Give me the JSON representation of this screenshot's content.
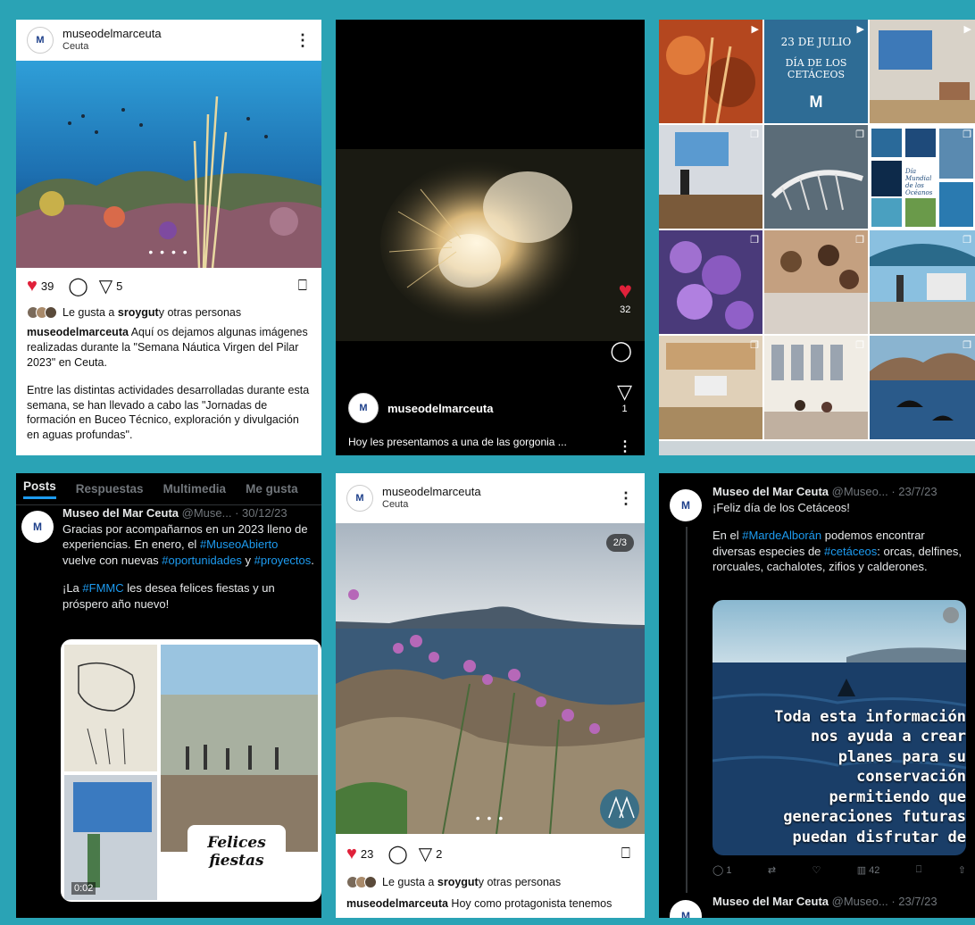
{
  "panel1": {
    "username": "museodelmarceuta",
    "location": "Ceuta",
    "logo_letter": "M",
    "likes_count": "39",
    "shares_count": "5",
    "liked_by_prefix": "Le gusta a ",
    "liked_by_user": "sroygut",
    "liked_by_suffix": " y otras personas",
    "caption_user": "museodelmarceuta",
    "caption_p1": " Aquí os dejamos algunas imágenes realizadas durante la \"Semana Náutica Virgen del Pilar 2023\" en Ceuta.",
    "caption_p2": "Entre las distintas actividades desarrolladas durante esta semana, se han llevado a cabo las \"Jornadas de formación en Buceo Técnico, exploración y divulgación en aguas profundas\".",
    "carousel": "• • • •"
  },
  "panel2": {
    "username": "museodelmarceuta",
    "like_count": "32",
    "share_count": "1",
    "caption": "Hoy les presentamos a una de las gorgonia ..."
  },
  "panel3": {
    "tile_banner_line1": "23 DE JULIO",
    "tile_banner_line2": "DÍA DE LOS CETÁCEOS",
    "tile_poster_line1": "Día Mundial",
    "tile_poster_line2": "de los",
    "tile_poster_line3": "Océanos"
  },
  "panel4": {
    "tabs": [
      "Posts",
      "Respuestas",
      "Multimedia",
      "Me gusta"
    ],
    "name": "Museo del Mar Ceuta",
    "handle": "@Muse... · 30/12/23",
    "line1": "Gracias por acompañarnos en un 2023 lleno de experiencias. En enero, el ",
    "tag1": "#MuseoAbierto",
    "line2": " vuelve con nuevas ",
    "tag2": "#oportunidades",
    "line3": " y ",
    "tag3": "#proyectos",
    "line4": ".",
    "line5a": "¡La ",
    "tag4": "#FMMC",
    "line5b": " les desea felices fiestas y un próspero año nuevo!",
    "collage_text1": "Felices",
    "collage_text2": "fiestas",
    "video_time": "0:02"
  },
  "panel5": {
    "username": "museodelmarceuta",
    "location": "Ceuta",
    "page_badge": "2/3",
    "likes_count": "23",
    "shares_count": "2",
    "liked_by_prefix": "Le gusta a ",
    "liked_by_user": "sroygut",
    "liked_by_suffix": " y otras personas",
    "caption_user": "museodelmarceuta",
    "caption_text": " Hoy como protagonista tenemos",
    "carousel": "• • •"
  },
  "panel6": {
    "name": "Museo del Mar Ceuta",
    "handle": "@Museo... · 23/7/23",
    "line1": "¡Feliz día de los Cetáceos!",
    "line2a": "En el ",
    "tag1": "#MardeAlborán",
    "line2b": " podemos encontrar diversas especies de ",
    "tag2": "#cetáceos",
    "line2c": ": orcas, delfines, rorcuales, cachalotes, zifios y calderones.",
    "overlay": [
      "Toda esta información",
      "nos ayuda a crear",
      "planes para su",
      "conservación",
      "permitiendo que",
      "generaciones futuras",
      "puedan disfrutar de"
    ],
    "reply_count": "1",
    "views_count": "42",
    "next_name": "Museo del Mar Ceuta",
    "next_handle": "@Museo... · 23/7/23"
  },
  "colors": {
    "frame": "#2aa3b5",
    "like_red": "#e0213a",
    "x_blue": "#1d9bf0"
  }
}
